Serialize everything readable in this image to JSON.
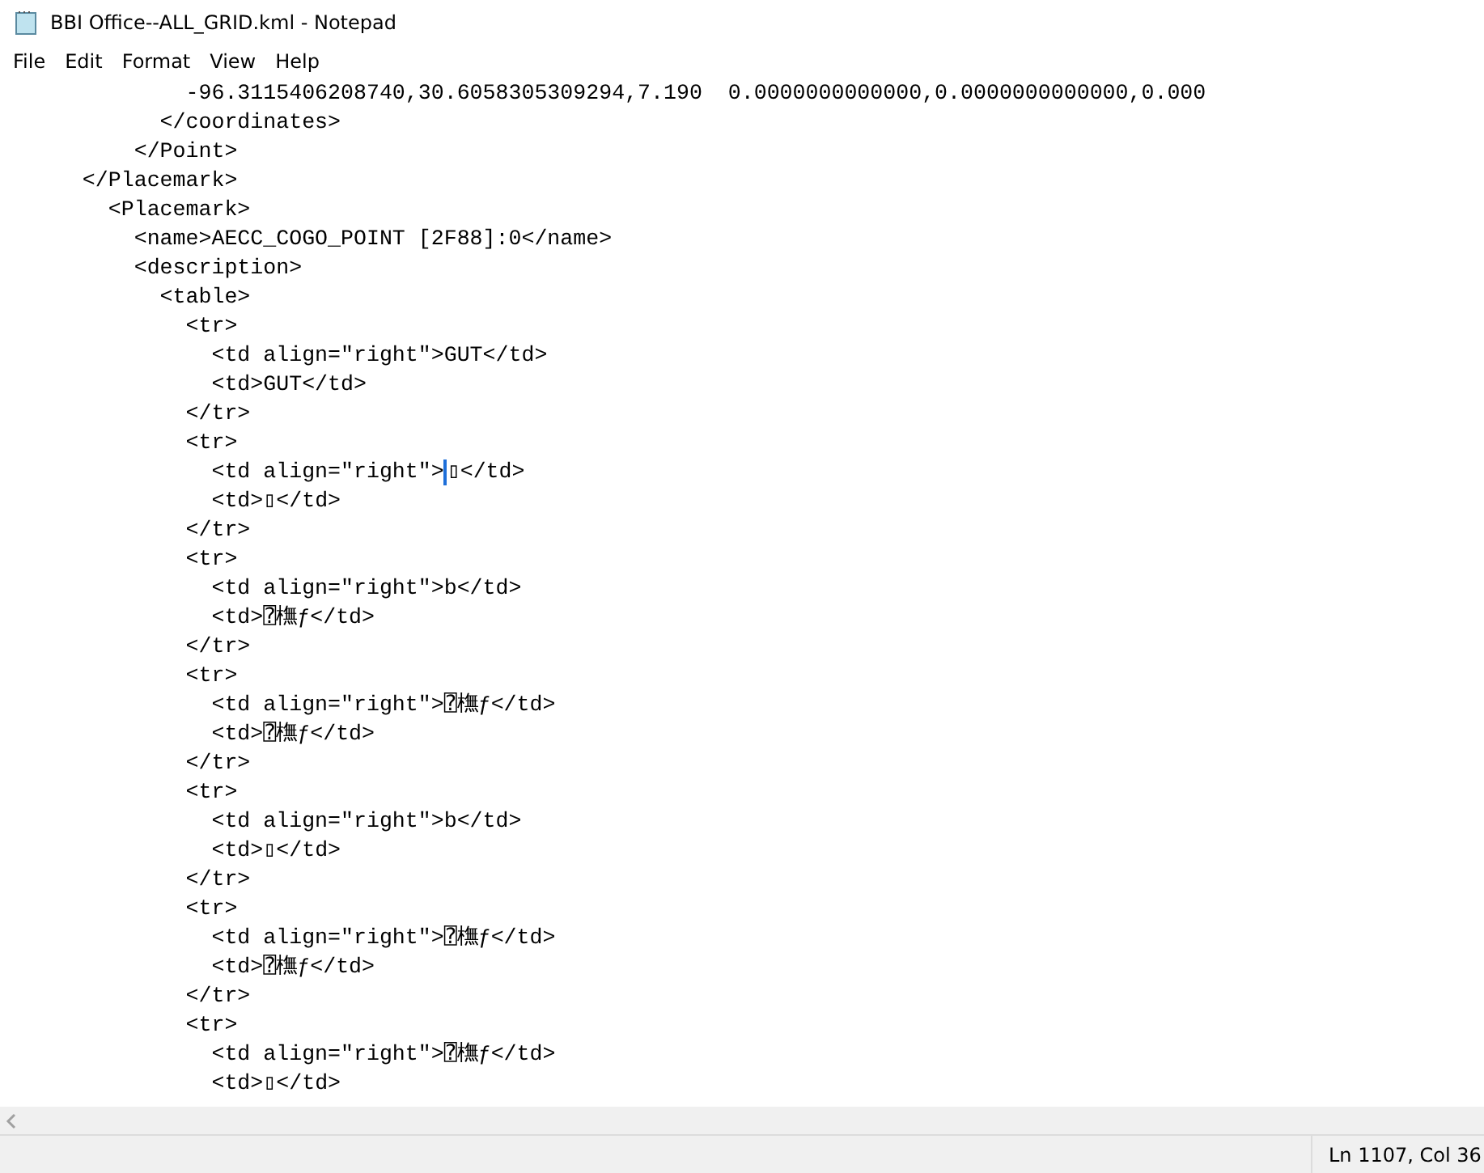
{
  "window": {
    "title": "BBI Office--ALL_GRID.kml - Notepad"
  },
  "menu": [
    "File",
    "Edit",
    "Format",
    "View",
    "Help"
  ],
  "lines": [
    {
      "text": "            -96.3115406208740,30.6058305309294,7.190  0.0000000000000,0.0000000000000,0.000",
      "caret": false
    },
    {
      "text": "          </coordinates>",
      "caret": false
    },
    {
      "text": "        </Point>",
      "caret": false
    },
    {
      "text": "    </Placemark>",
      "caret": false
    },
    {
      "text": "      <Placemark>",
      "caret": false
    },
    {
      "text": "        <name>AECC_COGO_POINT [2F88]:0</name>",
      "caret": false
    },
    {
      "text": "        <description>",
      "caret": false
    },
    {
      "text": "          <table>",
      "caret": false
    },
    {
      "text": "            <tr>",
      "caret": false
    },
    {
      "text": "              <td align=\"right\">GUT</td>",
      "caret": false
    },
    {
      "text": "              <td>GUT</td>",
      "caret": false
    },
    {
      "text": "            </tr>",
      "caret": false
    },
    {
      "text": "            <tr>",
      "caret": false
    },
    {
      "text": "              <td align=\"right\">",
      "after": "▯</td>",
      "caret": true
    },
    {
      "text": "              <td>▯</td>",
      "caret": false
    },
    {
      "text": "            </tr>",
      "caret": false
    },
    {
      "text": "            <tr>",
      "caret": false
    },
    {
      "text": "              <td align=\"right\">b</td>",
      "caret": false
    },
    {
      "text": "              <td>⍰橅ƒ</td>",
      "caret": false
    },
    {
      "text": "            </tr>",
      "caret": false
    },
    {
      "text": "            <tr>",
      "caret": false
    },
    {
      "text": "              <td align=\"right\">⍰橅ƒ</td>",
      "caret": false
    },
    {
      "text": "              <td>⍰橅ƒ</td>",
      "caret": false
    },
    {
      "text": "            </tr>",
      "caret": false
    },
    {
      "text": "            <tr>",
      "caret": false
    },
    {
      "text": "              <td align=\"right\">b</td>",
      "caret": false
    },
    {
      "text": "              <td>▯</td>",
      "caret": false
    },
    {
      "text": "            </tr>",
      "caret": false
    },
    {
      "text": "            <tr>",
      "caret": false
    },
    {
      "text": "              <td align=\"right\">⍰橅ƒ</td>",
      "caret": false
    },
    {
      "text": "              <td>⍰橅ƒ</td>",
      "caret": false
    },
    {
      "text": "            </tr>",
      "caret": false
    },
    {
      "text": "            <tr>",
      "caret": false
    },
    {
      "text": "              <td align=\"right\">⍰橅ƒ</td>",
      "caret": false
    },
    {
      "text": "              <td>▯</td>",
      "caret": false
    }
  ],
  "status_bar": {
    "position": "Ln 1107, Col 36"
  }
}
